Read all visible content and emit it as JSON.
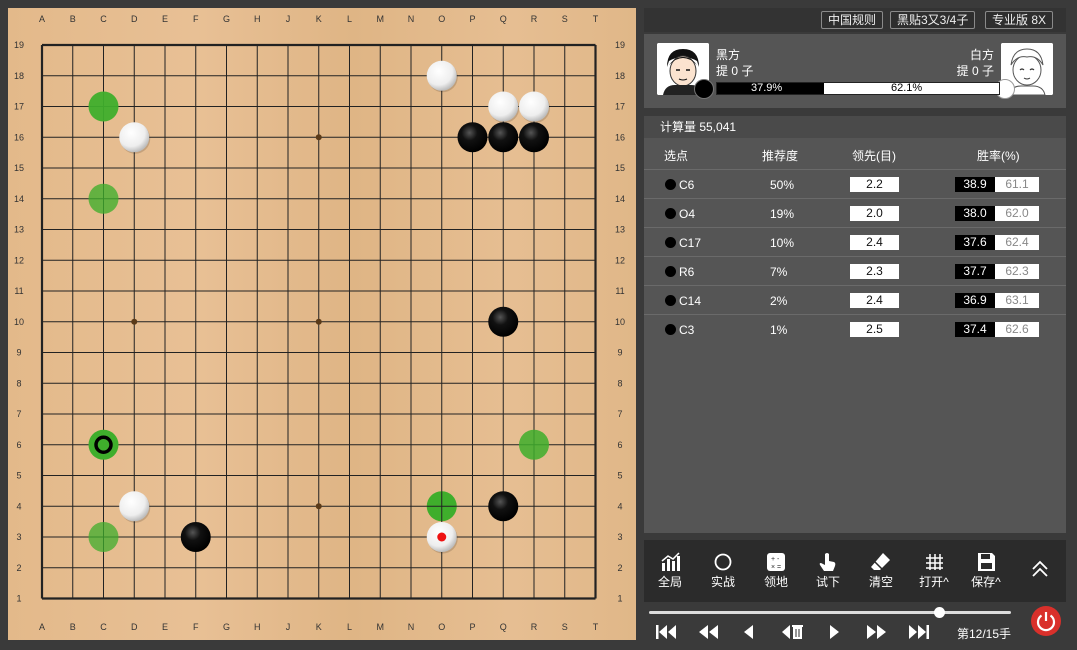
{
  "board": {
    "size": 19,
    "col_labels": [
      "A",
      "B",
      "C",
      "D",
      "E",
      "F",
      "G",
      "H",
      "J",
      "K",
      "L",
      "M",
      "N",
      "O",
      "P",
      "Q",
      "R",
      "S",
      "T"
    ],
    "row_labels": [
      "19",
      "18",
      "17",
      "16",
      "15",
      "14",
      "13",
      "12",
      "11",
      "10",
      "9",
      "8",
      "7",
      "6",
      "5",
      "4",
      "3",
      "2",
      "1"
    ],
    "star_points": [
      "D16",
      "K16",
      "Q16",
      "D10",
      "K10",
      "Q10",
      "D4",
      "K4",
      "Q4"
    ],
    "stones": [
      {
        "color": "white",
        "point": "O18"
      },
      {
        "color": "white",
        "point": "Q17"
      },
      {
        "color": "white",
        "point": "R17"
      },
      {
        "color": "white",
        "point": "D16"
      },
      {
        "color": "black",
        "point": "P16"
      },
      {
        "color": "black",
        "point": "Q16"
      },
      {
        "color": "black",
        "point": "R16"
      },
      {
        "color": "black",
        "point": "Q10"
      },
      {
        "color": "white",
        "point": "D4"
      },
      {
        "color": "black",
        "point": "Q4"
      },
      {
        "color": "black",
        "point": "F3"
      },
      {
        "color": "white",
        "point": "O3",
        "last_move": true
      }
    ],
    "suggestions": [
      {
        "point": "C6",
        "best": true
      },
      {
        "point": "O4",
        "strength": 1.0
      },
      {
        "point": "C17",
        "strength": 0.9
      },
      {
        "point": "R6",
        "strength": 0.75
      },
      {
        "point": "C14",
        "strength": 0.6
      },
      {
        "point": "C3",
        "strength": 0.55
      }
    ],
    "colors": {
      "suggest": "#3fae2c",
      "last_move_mark": "#ee1111",
      "grid": "#222222"
    }
  },
  "header": {
    "tags": [
      "中国规则",
      "黑贴3又3/4子",
      "专业版 8X"
    ]
  },
  "players": {
    "black": {
      "name": "黑方",
      "captures": "提 0 子"
    },
    "white": {
      "name": "白方",
      "captures": "提 0 子"
    },
    "black_winrate": 37.9,
    "black_winrate_label": "37.9%",
    "white_winrate_label": "62.1%"
  },
  "analysis": {
    "calc_label": "计算量 55,041",
    "headers": {
      "move": "选点",
      "rec": "推荐度",
      "lead": "领先(目)",
      "win": "胜率(%)"
    },
    "rows": [
      {
        "move": "C6",
        "rec": "50%",
        "lead": "2.2",
        "win_b": "38.9",
        "win_w": "61.1"
      },
      {
        "move": "O4",
        "rec": "19%",
        "lead": "2.0",
        "win_b": "38.0",
        "win_w": "62.0"
      },
      {
        "move": "C17",
        "rec": "10%",
        "lead": "2.4",
        "win_b": "37.6",
        "win_w": "62.4"
      },
      {
        "move": "R6",
        "rec": "7%",
        "lead": "2.3",
        "win_b": "37.7",
        "win_w": "62.3"
      },
      {
        "move": "C14",
        "rec": "2%",
        "lead": "2.4",
        "win_b": "36.9",
        "win_w": "63.1"
      },
      {
        "move": "C3",
        "rec": "1%",
        "lead": "2.5",
        "win_b": "37.4",
        "win_w": "62.6"
      }
    ]
  },
  "toolbar": {
    "items": [
      {
        "label": "全局",
        "icon": "chart-bar-icon"
      },
      {
        "label": "实战",
        "icon": "circle-icon"
      },
      {
        "label": "领地",
        "icon": "calculator-icon"
      },
      {
        "label": "试下",
        "icon": "hand-pointer-icon"
      },
      {
        "label": "清空",
        "icon": "eraser-icon"
      },
      {
        "label": "打开^",
        "icon": "grid-icon"
      },
      {
        "label": "保存^",
        "icon": "save-icon"
      }
    ]
  },
  "navigation": {
    "move_label": "第12/15手",
    "progress": 0.8
  }
}
